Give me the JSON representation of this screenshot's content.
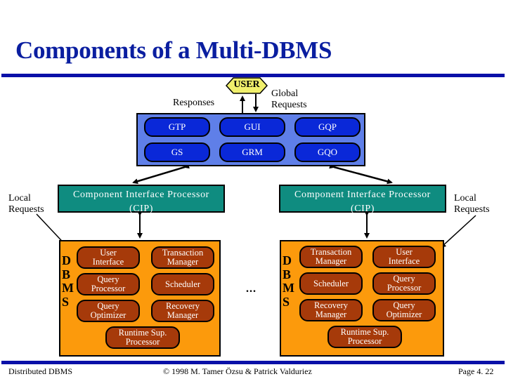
{
  "slide": {
    "title": "Components of a Multi-DBMS",
    "colors": {
      "title": "#0a1ea0",
      "rule": "#0a10a8",
      "global_box": "#5f7fe8",
      "global_module": "#0a28d8",
      "cip": "#0f8c80",
      "dbms_box": "#fc9a0c",
      "dbms_module": "#a63a0a",
      "user_badge": "#f0ef6c"
    }
  },
  "user": {
    "label": "USER"
  },
  "labels": {
    "responses": "Responses",
    "global_requests_line1": "Global",
    "global_requests_line2": "Requests",
    "local_requests_left_line1": "Local",
    "local_requests_left_line2": "Requests",
    "local_requests_right_line1": "Local",
    "local_requests_right_line2": "Requests",
    "ellipsis": "..."
  },
  "global_modules": [
    {
      "label": "GTP"
    },
    {
      "label": "GUI"
    },
    {
      "label": "GQP"
    },
    {
      "label": "GS"
    },
    {
      "label": "GRM"
    },
    {
      "label": "GQO"
    }
  ],
  "cip": {
    "left": {
      "line1": "Component Interface Processor",
      "line2": "(CIP)"
    },
    "right": {
      "line1": "Component Interface Processor",
      "line2": "(CIP)"
    }
  },
  "dbms_letters": [
    "D",
    "B",
    "M",
    "S"
  ],
  "dbms_left": {
    "modules": [
      {
        "line1": "User",
        "line2": "Interface"
      },
      {
        "line1": "Transaction",
        "line2": "Manager"
      },
      {
        "line1": "Query",
        "line2": "Processor"
      },
      {
        "line1": "Scheduler",
        "line2": ""
      },
      {
        "line1": "Query",
        "line2": "Optimizer"
      },
      {
        "line1": "Recovery",
        "line2": "Manager"
      },
      {
        "line1": "Runtime Sup.",
        "line2": "Processor"
      }
    ]
  },
  "dbms_right": {
    "modules": [
      {
        "line1": "Transaction",
        "line2": "Manager"
      },
      {
        "line1": "User",
        "line2": "Interface"
      },
      {
        "line1": "Scheduler",
        "line2": ""
      },
      {
        "line1": "Query",
        "line2": "Processor"
      },
      {
        "line1": "Recovery",
        "line2": "Manager"
      },
      {
        "line1": "Query",
        "line2": "Optimizer"
      },
      {
        "line1": "Runtime Sup.",
        "line2": "Processor"
      }
    ]
  },
  "footer": {
    "left": "Distributed DBMS",
    "center": "© 1998 M. Tamer Özsu & Patrick Valduriez",
    "right": "Page 4. 22"
  }
}
